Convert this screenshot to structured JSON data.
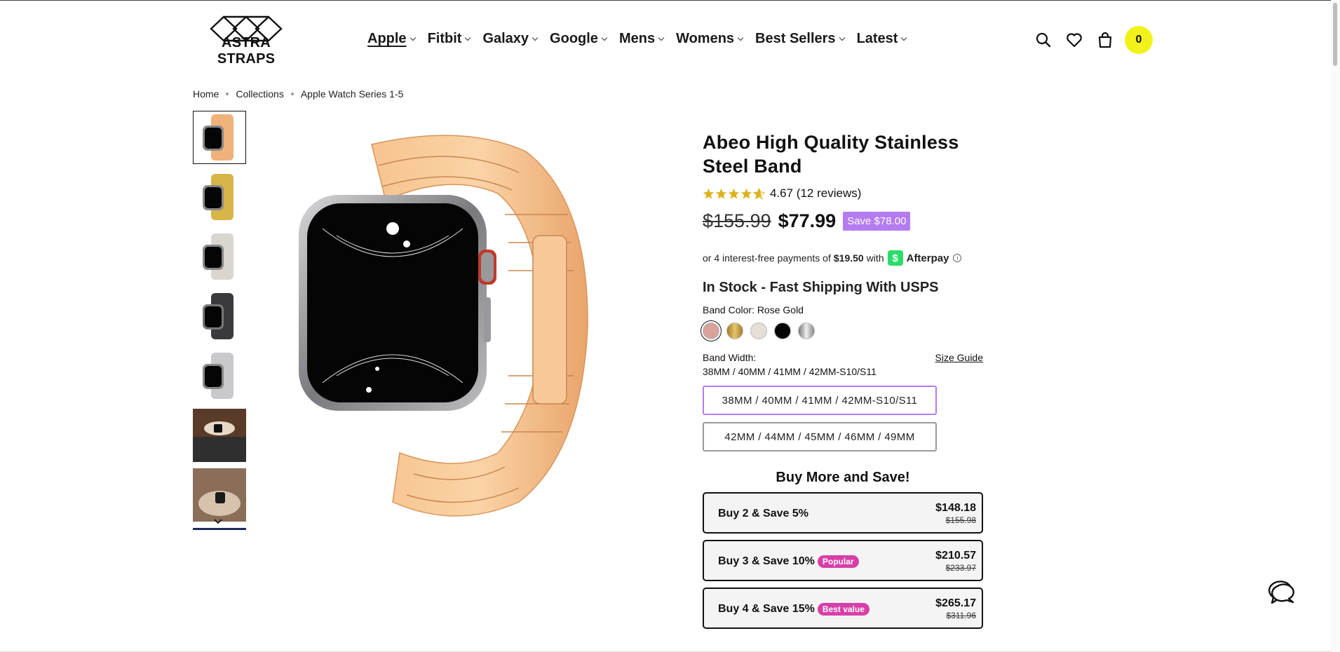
{
  "header": {
    "logo_text": "ASTRA STRAPS",
    "nav": [
      {
        "label": "Apple"
      },
      {
        "label": "Fitbit"
      },
      {
        "label": "Galaxy"
      },
      {
        "label": "Google"
      },
      {
        "label": "Mens"
      },
      {
        "label": "Womens"
      },
      {
        "label": "Best Sellers"
      },
      {
        "label": "Latest"
      }
    ],
    "icons": [
      "search-icon",
      "heart-icon",
      "bag-icon"
    ],
    "cart_count": "0",
    "cart_badge_color": "#f2f21a"
  },
  "breadcrumb": [
    "Home",
    "Collections",
    "Apple Watch Series 1-5"
  ],
  "gallery": {
    "thumbnails": [
      "rose-gold",
      "gold",
      "starlight",
      "black",
      "silver",
      "lifestyle-photo",
      "lifestyle-photo"
    ],
    "selected_index": 0
  },
  "product": {
    "title": "Abeo High Quality Stainless Steel Band",
    "rating_value": 4.67,
    "rating_text": "4.67 (12 reviews)",
    "old_price": "$155.99",
    "price": "$77.99",
    "save_badge": "Save $78.00",
    "afterpay": {
      "prefix": "or 4 interest-free payments of",
      "amount": "$19.50",
      "with": "with",
      "brand": "Afterpay",
      "info": "i"
    },
    "stock": "In Stock - Fast Shipping With USPS",
    "color_label": "Band Color: Rose Gold",
    "colors": [
      "#d9a29a",
      "#c9a24c",
      "#e6dfd6",
      "#050505",
      "#b4b4b8"
    ],
    "width_label": "Band Width:",
    "width_selected": "38MM / 40MM / 41MM / 42MM-S10/S11",
    "size_guide": "Size Guide",
    "width_options": [
      "38MM / 40MM / 41MM / 42MM-S10/S11",
      "42MM / 44MM / 45MM / 46MM / 49MM"
    ],
    "accent_color": "#b57cf2"
  },
  "bundles": {
    "heading": "Buy More and Save!",
    "items": [
      {
        "label": "Buy 2 & Save 5%",
        "tag": "",
        "price": "$148.18",
        "old_price": "$155.98"
      },
      {
        "label": "Buy 3 & Save 10%",
        "tag": "Popular",
        "price": "$210.57",
        "old_price": "$233.97"
      },
      {
        "label": "Buy 4 & Save 15%",
        "tag": "Best value",
        "price": "$265.17",
        "old_price": "$311.96"
      }
    ],
    "tag_color": "#d83ea8"
  }
}
